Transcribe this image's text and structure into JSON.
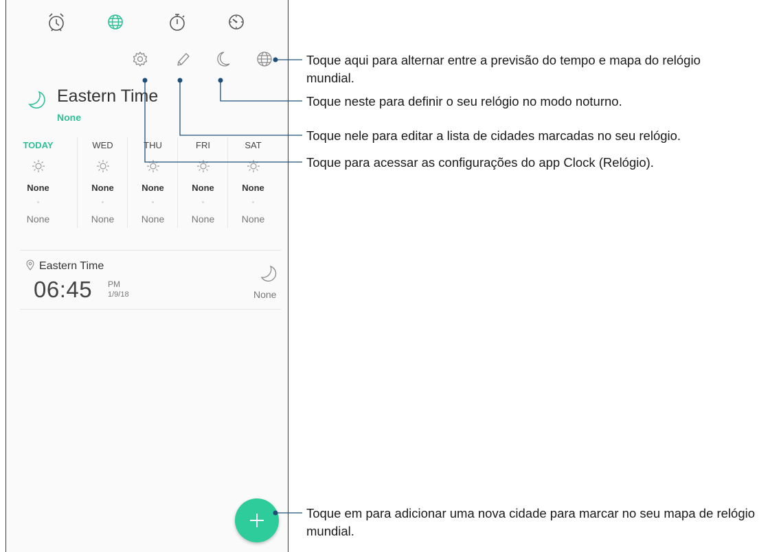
{
  "tabs": [
    {
      "icon": "alarm-clock-icon",
      "active": false
    },
    {
      "icon": "globe-icon",
      "active": true
    },
    {
      "icon": "stopwatch-icon",
      "active": false
    },
    {
      "icon": "timer-icon",
      "active": false
    }
  ],
  "toolbar_icons": [
    "gear-icon",
    "pencil-icon",
    "moon-icon",
    "globe-icon"
  ],
  "header": {
    "city": "Eastern Time",
    "condition": "None"
  },
  "forecast": [
    {
      "day": "TODAY",
      "high": "None",
      "low": "None"
    },
    {
      "day": "WED",
      "high": "None",
      "low": "None"
    },
    {
      "day": "THU",
      "high": "None",
      "low": "None"
    },
    {
      "day": "FRI",
      "high": "None",
      "low": "None"
    },
    {
      "day": "SAT",
      "high": "None",
      "low": "None"
    }
  ],
  "city_row": {
    "name": "Eastern Time",
    "time": "06:45",
    "ampm": "PM",
    "date": "1/9/18",
    "condition": "None"
  },
  "callouts": {
    "globe": "Toque aqui para alternar entre a previsão do tempo e mapa do relógio mundial.",
    "moon": "Toque neste para definir o seu relógio no modo noturno.",
    "pencil": "Toque nele para editar a lista de cidades marcadas no seu relógio.",
    "settings": "Toque para acessar as configurações do app Clock (Relógio).",
    "add": "Toque em para adicionar uma nova cidade para marcar no seu mapa de relógio mundial."
  },
  "colors": {
    "accent": "#2fbf97",
    "fab": "#2ecc9a",
    "icon_gray": "#8a8a8a",
    "callout_line": "#1d4f7a"
  }
}
